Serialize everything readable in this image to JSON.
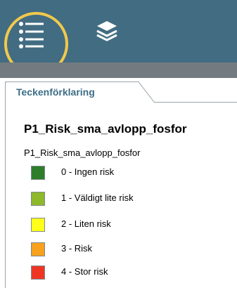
{
  "toolbar": {
    "legend_icon": "list-icon",
    "layers_icon": "layers-icon",
    "background_color": "#426c82",
    "highlight_color": "#f2c94c"
  },
  "legend": {
    "tab_label": "Teckenförklaring",
    "title": "P1_Risk_sma_avlopp_fosfor",
    "layer_name": "P1_Risk_sma_avlopp_fosfor",
    "items": [
      {
        "label": "0 - Ingen risk",
        "color": "#2e7d2a"
      },
      {
        "label": "1 - Väldigt lite risk",
        "color": "#8fb82a"
      },
      {
        "label": "2 - Liten risk",
        "color": "#ffff1a"
      },
      {
        "label": "3 - Risk",
        "color": "#f7a11c"
      },
      {
        "label": "4 - Stor risk",
        "color": "#ee3524"
      }
    ]
  }
}
